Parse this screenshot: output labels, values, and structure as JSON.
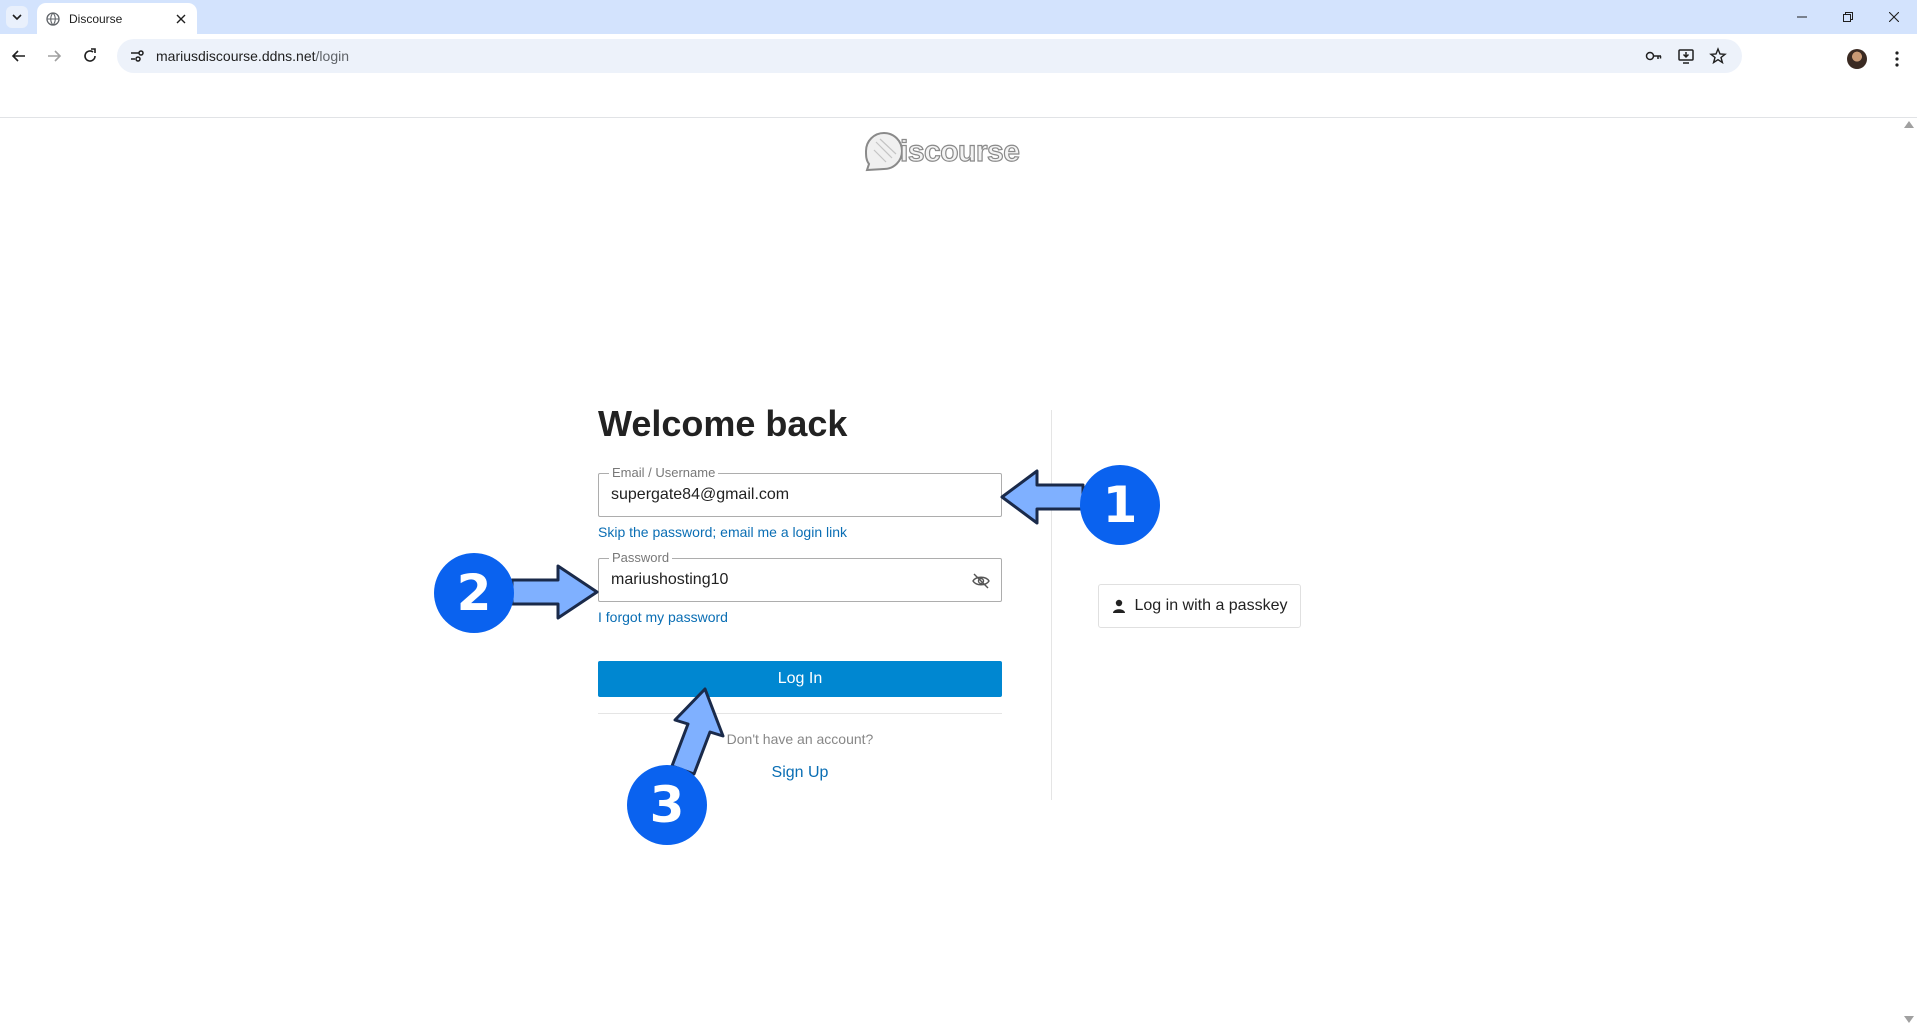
{
  "browser": {
    "tab_title": "Discourse",
    "url_host": "mariusdiscourse.ddns.net",
    "url_path": "/login"
  },
  "page": {
    "logo_text": "iscourse",
    "title": "Welcome back",
    "email_label": "Email / Username",
    "email_value": "supergate84@gmail.com",
    "skip_password_link": "Skip the password; email me a login link",
    "password_label": "Password",
    "password_value": "mariushosting10",
    "forgot_password_link": "I forgot my password",
    "login_button": "Log In",
    "no_account_text": "Don't have an account?",
    "signup_link": "Sign Up",
    "passkey_button": "Log in with a passkey"
  },
  "annotations": {
    "badge_1": "1",
    "badge_2": "2",
    "badge_3": "3",
    "badge_color": "#0a62ef",
    "arrow_color": "#7fb0ff"
  },
  "colors": {
    "tabbar": "#d3e3fd",
    "primary_button": "#0087d1",
    "link": "#0a6eb4"
  }
}
